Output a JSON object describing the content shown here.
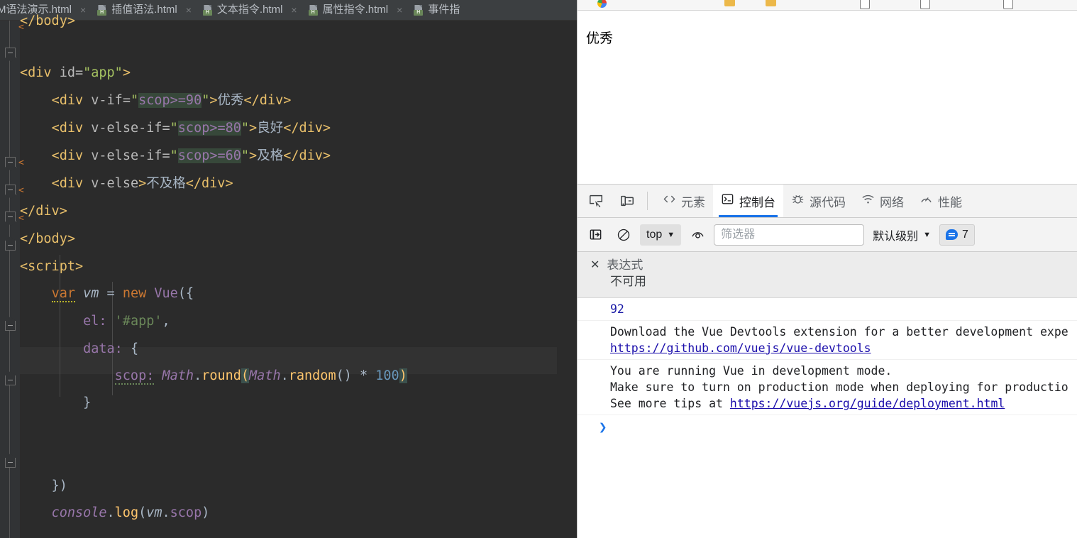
{
  "ide": {
    "tabs": [
      {
        "label": "M语法演示.html",
        "icon": "html-file-icon",
        "close": "×",
        "badge": "H"
      },
      {
        "label": "插值语法.html",
        "icon": "html-file-icon",
        "close": "×",
        "badge": "H"
      },
      {
        "label": "文本指令.html",
        "icon": "html-file-icon",
        "close": "×",
        "badge": "H"
      },
      {
        "label": "属性指令.html",
        "icon": "html-file-icon",
        "close": "×",
        "badge": "H"
      },
      {
        "label": "事件指",
        "icon": "html-file-icon",
        "close": "×",
        "badge": "H"
      }
    ],
    "code_lines": [
      "</body>",
      "<div id=\"app\">",
      "    <div v-if=\"scop>=90\">优秀</div>",
      "    <div v-else-if=\"scop>=80\">良好</div>",
      "    <div v-else-if=\"scop>=60\">及格</div>",
      "    <div v-else>不及格</div>",
      "</div>",
      "</body>",
      "<script>",
      "    var vm = new Vue({",
      "        el: '#app',",
      "        data: {",
      "            scop: Math.round(Math.random() * 100)",
      "        }",
      "",
      "",
      "    })",
      "    console.log(vm.scop)"
    ],
    "tokens": {
      "body_close_top": "</body>",
      "div_open": "<div ",
      "id_attr": "id=",
      "app_val": "\"app\"",
      "gt": ">",
      "div_tag": "<div ",
      "v_if": "v-if=",
      "v_else_if": "v-else-if=",
      "v_else": "v-else",
      "q": "\"",
      "cond90": "scop>=90",
      "cond80": "scop>=80",
      "cond60": "scop>=60",
      "t_excellent": "优秀",
      "t_good": "良好",
      "t_pass": "及格",
      "t_fail": "不及格",
      "div_end": "</div>",
      "body_end": "</body>",
      "script_open": "<script>",
      "kw_var": "var",
      "vm": "vm",
      "eq": "=",
      "kw_new": "new",
      "vue": "Vue",
      "paren_brace": "({",
      "el_key": "el:",
      "app_str": "'#app'",
      "comma": ",",
      "data_key": "data:",
      "brace_open": "{",
      "scop_key": "scop:",
      "math": "Math",
      "dot": ".",
      "round": "round",
      "lparen": "(",
      "random": "random",
      "empty_parens": "()",
      "star": "*",
      "hundred": "100",
      "rparen": ")",
      "brace_close": "}",
      "close_call": "})",
      "console": "console",
      "log": "log",
      "vm_scop": "vm",
      "scop_prop": "scop"
    }
  },
  "browser": {
    "bookmarks_icons": [
      "chrome-icon",
      "folder-icon",
      "folder-icon",
      "page-icon",
      "page-icon",
      "page-icon"
    ],
    "viewport_text": "优秀"
  },
  "devtools": {
    "toolbar_icons": [
      {
        "name": "inspect-element-icon"
      },
      {
        "name": "device-toolbar-icon"
      }
    ],
    "tabs": [
      {
        "label": "元素",
        "icon": "elements-icon",
        "active": false
      },
      {
        "label": "控制台",
        "icon": "console-icon",
        "active": true
      },
      {
        "label": "源代码",
        "icon": "sources-bug-icon",
        "active": false
      },
      {
        "label": "网络",
        "icon": "network-wifi-icon",
        "active": false
      },
      {
        "label": "性能",
        "icon": "performance-icon",
        "active": false
      }
    ],
    "console_toolbar": {
      "sidebar_toggle_icon": "sidebar-toggle-icon",
      "clear_icon": "clear-console-icon",
      "context": "top",
      "context_caret": "▼",
      "eye_icon": "live-expression-eye-icon",
      "filter_placeholder": "筛选器",
      "filter_value": "",
      "level": "默认级别",
      "level_caret": "▼",
      "message_count": "7",
      "message_icon": "message-bubble-icon"
    },
    "live_expression": {
      "close_icon": "✕",
      "title": "表达式",
      "value": "不可用"
    },
    "console_messages": [
      {
        "type": "value",
        "text": "92"
      },
      {
        "type": "info",
        "lines": [
          {
            "text": "Download the Vue Devtools extension for a better development expe"
          },
          {
            "text": "https://github.com/vuejs/vue-devtools",
            "link": true
          }
        ]
      },
      {
        "type": "info",
        "lines": [
          {
            "text": "You are running Vue in development mode."
          },
          {
            "text": "Make sure to turn on production mode when deploying for productio"
          },
          {
            "text": "See more tips at ",
            "suffix_link": "https://vuejs.org/guide/deployment.html"
          }
        ]
      }
    ],
    "prompt_symbol": "❯"
  },
  "colors": {
    "ide_bg": "#2b2b2b",
    "ide_tabbar": "#3c3f41",
    "accent_blue": "#1a73e8",
    "link_blue": "#1a0dab",
    "value_blue": "#1a1aa6",
    "highlight_green": "#37483a"
  }
}
